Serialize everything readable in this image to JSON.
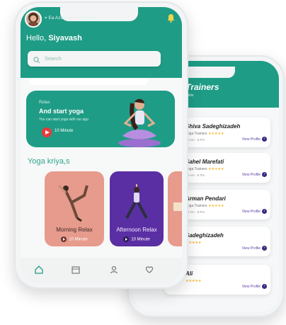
{
  "colors": {
    "primary": "#1f9c86",
    "purple": "#5a2fa3",
    "pink": "#e79b8c",
    "red": "#e83a3a"
  },
  "front": {
    "location": "Ea Azarbaijan - Tabriz",
    "hello_prefix": "Hello, ",
    "user_name": "Siyavash",
    "search_placeholder": "Search",
    "promo": {
      "kicker": "Relax",
      "title": "And start yoga",
      "desc": "You can start yoga with our app",
      "duration": "10 Minute"
    },
    "section_title": "Yoga kriya,s",
    "kriyas": [
      {
        "label": "Morning Relax",
        "duration": "10 Minute"
      },
      {
        "label": "Afternoon Relax",
        "duration": "10 Minute"
      }
    ],
    "tabs": [
      "home-icon",
      "calendar-icon",
      "user-icon",
      "heart-icon"
    ]
  },
  "back": {
    "title": "Yoga Trainers",
    "subtitle": "4 Trainers Available",
    "trainers": [
      {
        "name": "Shiva Sadeghizadeh",
        "meta": "Yoga Trainers",
        "stars": "★★★★★",
        "time": "30 Am - 8 Pm",
        "profile": "View Profile"
      },
      {
        "name": "Sahel Marefati",
        "meta": "Yoga Trainers",
        "stars": "★★★★★",
        "time": "30 Am - 8 Pm",
        "profile": "View Profile"
      },
      {
        "name": "Arman Pendari",
        "meta": "Yoga Trainers",
        "stars": "★★★★★",
        "time": "30 Am - 8 Pm",
        "profile": "View Profile"
      },
      {
        "name": "Sadeghizadeh",
        "meta": "",
        "stars": "★★★★★",
        "time": "",
        "profile": "View Profile"
      },
      {
        "name": "Ali",
        "meta": "",
        "stars": "★★★★★",
        "time": "",
        "profile": "View Profile"
      }
    ]
  }
}
